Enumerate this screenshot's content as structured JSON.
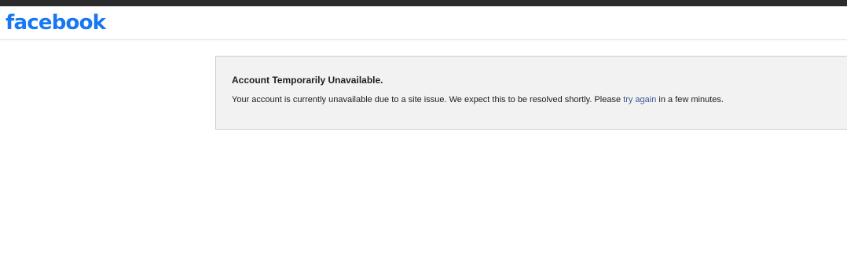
{
  "header": {
    "logo_text": "facebook"
  },
  "notice": {
    "title": "Account Temporarily Unavailable.",
    "body_before": "Your account is currently unavailable due to a site issue. We expect this to be resolved shortly. Please ",
    "link_text": "try again",
    "body_after": " in a few minutes."
  },
  "colors": {
    "brand": "#1877f2",
    "link": "#385898",
    "notice_background": "#f2f2f2",
    "notice_border": "#cccccc",
    "top_strip": "#2b2b2b"
  }
}
